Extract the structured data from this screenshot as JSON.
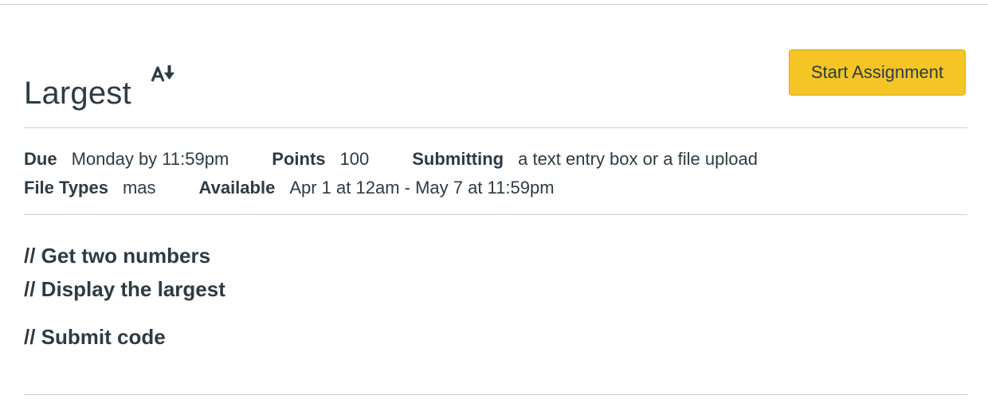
{
  "assignment": {
    "title": "Largest",
    "start_button": "Start Assignment"
  },
  "details": {
    "due_label": "Due",
    "due_value": "Monday by 11:59pm",
    "points_label": "Points",
    "points_value": "100",
    "submitting_label": "Submitting",
    "submitting_value": "a text entry box or a file upload",
    "file_types_label": "File Types",
    "file_types_value": "mas",
    "available_label": "Available",
    "available_value": "Apr 1 at 12am - May 7 at 11:59pm"
  },
  "description": {
    "lines": [
      "// Get two numbers",
      "// Display the largest",
      "// Submit code"
    ]
  },
  "icons": {
    "title_icon": "sort-alpha-down-icon"
  },
  "colors": {
    "accent_button": "#f5c526",
    "text": "#2d3b45",
    "divider": "#c7cdd1"
  }
}
